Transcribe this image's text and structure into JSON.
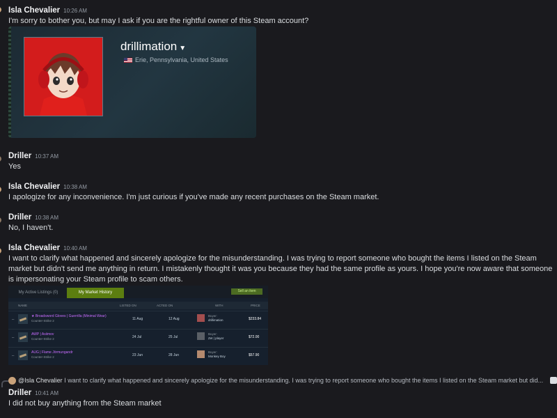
{
  "messages": [
    {
      "author": "Isla Chevalier",
      "time": "10:26 AM",
      "text": "I'm sorry to bother you, but may I ask if you are the rightful owner of this Steam account?"
    },
    {
      "author": "Driller",
      "time": "10:37 AM",
      "text": "Yes"
    },
    {
      "author": "Isla Chevalier",
      "time": "10:38 AM",
      "text": "I apologize for any inconvenience. I'm just curious if you've made any recent purchases on the Steam market."
    },
    {
      "author": "Driller",
      "time": "10:38 AM",
      "text": "No, I haven't."
    },
    {
      "author": "Isla Chevalier",
      "time": "10:40 AM",
      "text": "I want to clarify what happened and sincerely apologize for the misunderstanding. I was trying to report someone who bought the items I listed on the Steam market but didn't send me anything in return. I mistakenly thought it was you because they had the same profile as yours. I hope you're now aware that someone is impersonating your Steam profile to scam others."
    },
    {
      "author": "Driller",
      "time": "10:41 AM",
      "text": "I did not buy anything from the Steam market"
    }
  ],
  "steam_profile": {
    "name": "drillimation",
    "location": "Erie, Pennsylvania, United States"
  },
  "market": {
    "tabs": [
      "My Active Listings (0)",
      "My Market History"
    ],
    "sell_button": "Sell an item",
    "columns": [
      "NAME",
      "LISTED ON",
      "ACTED ON",
      "WITH",
      "PRICE"
    ],
    "rows": [
      {
        "name": "★ Broadsword Gloves | Guerrilla (Minimal Wear)",
        "game": "Counter-Strike 2",
        "listed": "11 Aug",
        "acted": "12 Aug",
        "with_label": "Buyer:",
        "with_name": "drillimation",
        "price": "$233.84"
      },
      {
        "name": "AWP | Asiimov",
        "game": "Counter-Strike 2",
        "listed": "24 Jul",
        "acted": "25 Jul",
        "with_label": "Buyer:",
        "with_name": "Zet | player",
        "price": "$72.00"
      },
      {
        "name": "AUG | Flame Jörmungandr",
        "game": "Counter-Strike 2",
        "listed": "23 Jun",
        "acted": "28 Jun",
        "with_label": "Buyer:",
        "with_name": "Monkey Boy",
        "price": "$57.90"
      }
    ]
  },
  "reply": {
    "mention": "@Isla Chevalier",
    "preview": "I want to clarify what happened and sincerely apologize for the misunderstanding. I was trying to report someone who bought the items I listed on the Steam market but did..."
  },
  "icons": {
    "reply_avatar": "user-avatar-icon",
    "image_attachment": "image-attachment-icon",
    "flag": "us-flag-icon",
    "dropdown": "caret-down-icon"
  },
  "colors": {
    "background": "#1a1a1e",
    "author": "#f2f3f5",
    "text": "#dbdee1",
    "timestamp": "#949ba4",
    "market_active_tab": "#5c7e10",
    "market_item_name": "#c86cff"
  }
}
